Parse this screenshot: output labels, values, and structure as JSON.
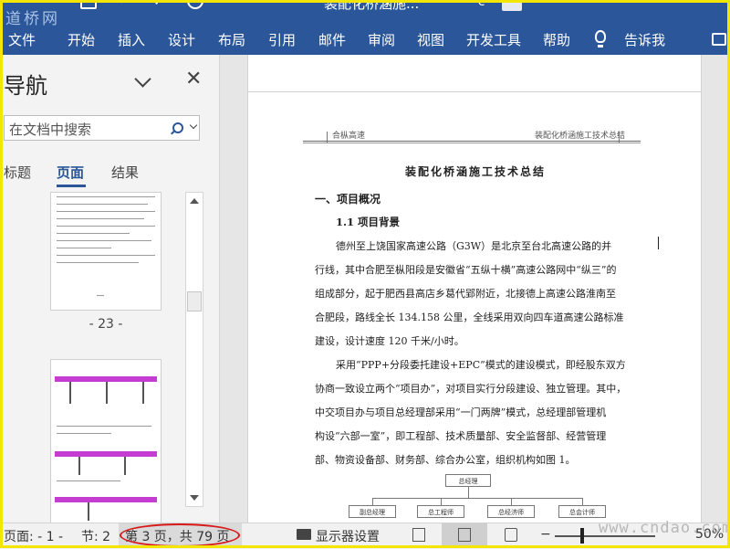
{
  "titlebar": {
    "watermark": "道桥网",
    "doc_title": "装配化桥涵施..."
  },
  "ribbon": {
    "tabs": [
      "文件",
      "开始",
      "插入",
      "设计",
      "布局",
      "引用",
      "邮件",
      "审阅",
      "视图",
      "开发工具",
      "帮助"
    ],
    "tell_me": "告诉我"
  },
  "nav": {
    "title": "导航",
    "search_placeholder": "在文档中搜索",
    "tabs": [
      "标题",
      "页面",
      "结果"
    ],
    "active_tab": "页面",
    "page_label": "- 23 -"
  },
  "document": {
    "header_left": "合枞高速",
    "header_right": "装配化桥涵施工技术总结",
    "title": "装配化桥涵施工技术总结",
    "heading1": "一、项目概况",
    "heading2": "1.1 项目背景",
    "paragraphs": [
      "德州至上饶国家高速公路（G3W）是北京至台北高速公路的并",
      "行线，其中合肥至枞阳段是安徽省“五纵十横”高速公路网中“纵三”的",
      "组成部分，起于肥西县高店乡葛代郢附近，北接德上高速公路淮南至",
      "合肥段，路线全长 134.158 公里，全线采用双向四车道高速公路标准",
      "建设，设计速度 120 千米/小时。",
      "采用“PPP+分段委托建设+EPC”模式的建设模式，即经股东双方",
      "协商一致设立两个“项目办”，对项目实行分段建设、独立管理。其中，",
      "中交项目办与项目总经理部采用“一门两牌”模式，总经理部管理机",
      "构设“六部一室”，即工程部、技术质量部、安全监督部、经营管理",
      "部、物资设备部、财务部、综合办公室，组织机构如图 1。"
    ],
    "org_chart": {
      "top": "总经理",
      "children": [
        "副总经理",
        "总工程师",
        "总经济师",
        "总会计师"
      ]
    }
  },
  "status": {
    "page_section": "页面: - 1 -",
    "section": "节: 2",
    "page_of": "第 3 页，共 79 页",
    "display_settings": "显示器设置",
    "zoom": "50%",
    "watermark": "www.cndao.com"
  }
}
